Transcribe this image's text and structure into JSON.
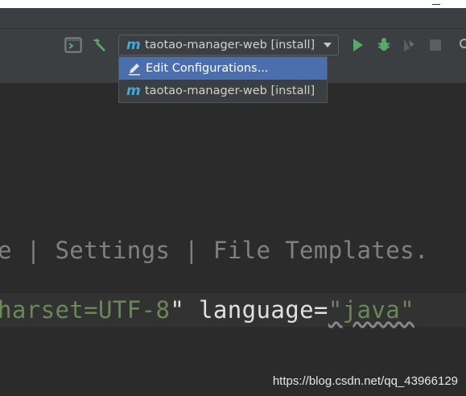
{
  "run_config": {
    "selected": "taotao-manager-web [install]",
    "icon": "maven-m-icon"
  },
  "dropdown": {
    "items": [
      {
        "label": "Edit Configurations...",
        "icon": "pencil-icon",
        "highlighted": true
      },
      {
        "label": "taotao-manager-web [install]",
        "icon": "maven-m-icon",
        "highlighted": false
      }
    ]
  },
  "editor": {
    "line1": "e | Settings | File Templates.",
    "line2_parts": [
      "harset=UTF-8",
      "\" language=",
      "\"java\"",
      " "
    ]
  },
  "watermark": "https://blog.csdn.net/qq_43966129",
  "colors": {
    "accent_selection": "#4b6eaf",
    "run_green": "#59a869",
    "maven_blue": "#3fa9e0"
  }
}
